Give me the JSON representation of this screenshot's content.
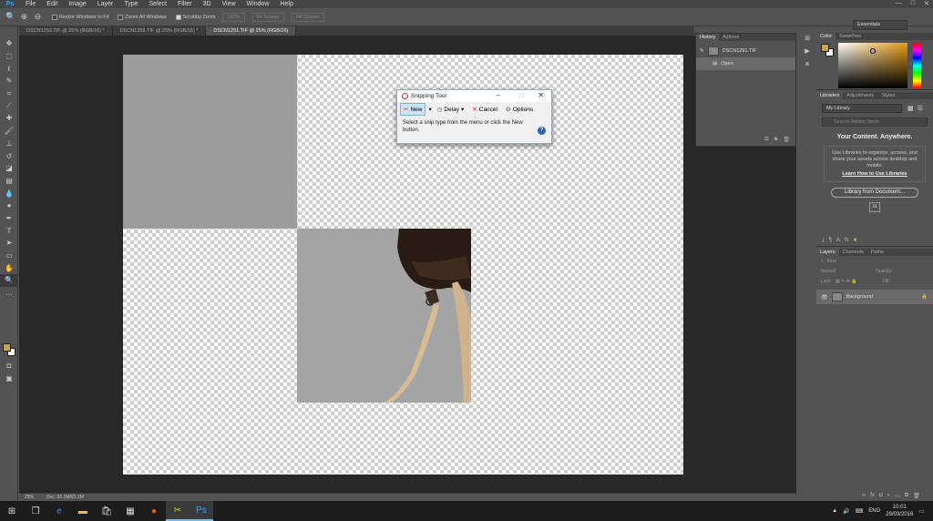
{
  "app": {
    "logo": "Ps"
  },
  "menu": [
    "File",
    "Edit",
    "Image",
    "Layer",
    "Type",
    "Select",
    "Filter",
    "3D",
    "View",
    "Window",
    "Help"
  ],
  "window_controls": [
    "—",
    "□",
    "✕"
  ],
  "options_bar": {
    "resize_windows": "Resize Windows to Fit",
    "zoom_all": "Zoom All Windows",
    "scrubby_zoom": "Scrubby Zoom",
    "btn_100": "100%",
    "btn_fit": "Fit Screen",
    "btn_fill": "Fill Screen",
    "workspace": "Essentials"
  },
  "doc_tabs": [
    {
      "label": "DSCN1253.TIF @ 25% (RGB/16) *",
      "active": false
    },
    {
      "label": "DSCN1259.TIF @ 25% (RGB/16) *",
      "active": false
    },
    {
      "label": "DSCN1291.TIF @ 25% (RGB/16)",
      "active": true
    }
  ],
  "status": {
    "zoom": "25%",
    "doc": "Doc: 91.1M/91.1M"
  },
  "snipping_tool": {
    "title": "Snipping Tool",
    "new": "New",
    "delay": "Delay",
    "cancel": "Cancel",
    "options": "Options",
    "message": "Select a snip type from the menu or click the New button."
  },
  "history_panel": {
    "tabs": [
      "History",
      "Actions"
    ],
    "snapshot": "DSCN1291.TIF",
    "step": "Open"
  },
  "color_panel": {
    "tabs": [
      "Color",
      "Swatches"
    ],
    "fg": "#c9a24a",
    "bg": "#ffffff"
  },
  "libraries_panel": {
    "tabs": [
      "Libraries",
      "Adjustments",
      "Styles"
    ],
    "library": "My Library",
    "search_placeholder": "Search Adobe Stock",
    "title": "Your Content. Anywhere.",
    "body": "Use Libraries to organize, access, and share your assets across desktop and mobile.",
    "link": "Learn How to Use Libraries",
    "button": "Library from Document...",
    "st": "St"
  },
  "layers_panel": {
    "tabs": [
      "Layers",
      "Channels",
      "Paths"
    ],
    "kind": "Kind",
    "blend": "Normal",
    "opacity": "Opacity:",
    "lock": "Lock:",
    "fill": "Fill:",
    "layer": "Background"
  },
  "taskbar": {
    "lang": "ENG",
    "time": "10:01",
    "date": "29/03/2016"
  }
}
